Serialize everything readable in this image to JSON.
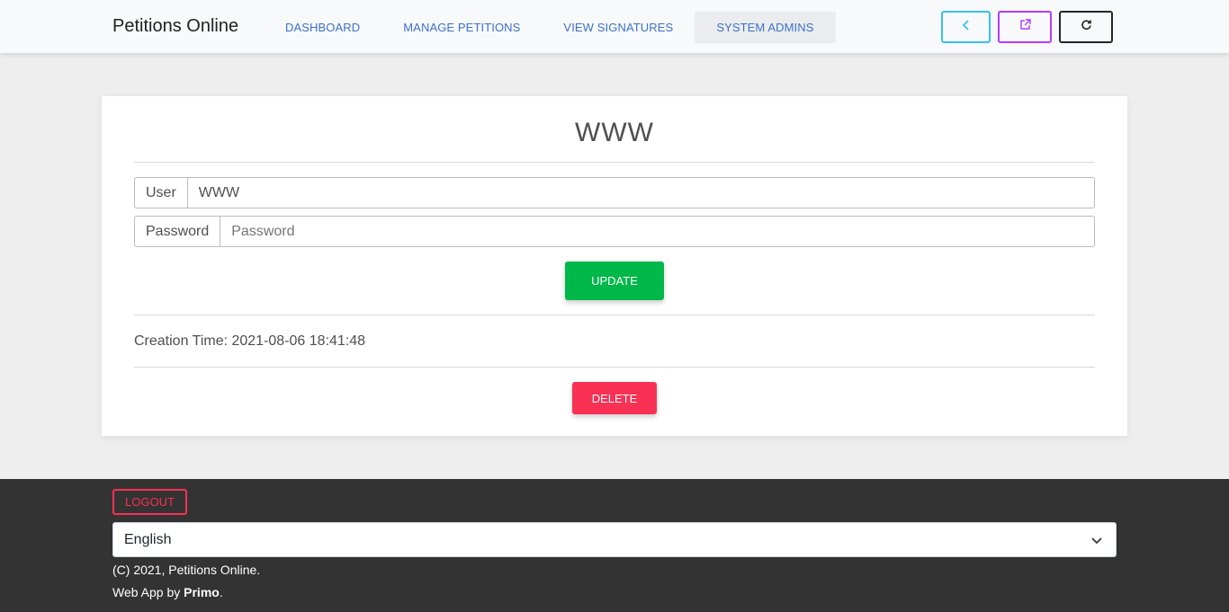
{
  "navbar": {
    "brand": "Petitions Online",
    "links": [
      {
        "label": "DASHBOARD"
      },
      {
        "label": "MANAGE PETITIONS"
      },
      {
        "label": "VIEW SIGNATURES"
      },
      {
        "label": "SYSTEM ADMINS"
      }
    ],
    "active_index": 3,
    "buttons": {
      "back_icon": "chevron-left-icon",
      "open_icon": "external-link-icon",
      "reload_icon": "reload-icon"
    }
  },
  "card": {
    "title": "WWW",
    "user_label": "User",
    "user_value": "WWW",
    "password_label": "Password",
    "password_placeholder": "Password",
    "update_label": "UPDATE",
    "creation_text": "Creation Time: 2021-08-06 18:41:48",
    "delete_label": "DELETE"
  },
  "footer": {
    "logout_label": "LOGOUT",
    "language_selected": "English",
    "copyright": "(C) 2021, Petitions Online.",
    "credit_prefix": "Web App by ",
    "credit_name": "Primo",
    "credit_suffix": "."
  },
  "colors": {
    "update": "#00b74a",
    "delete": "#f93154",
    "back_button": "#39c0ed",
    "open_button": "#b23cfd",
    "footer_bg": "#333333"
  }
}
